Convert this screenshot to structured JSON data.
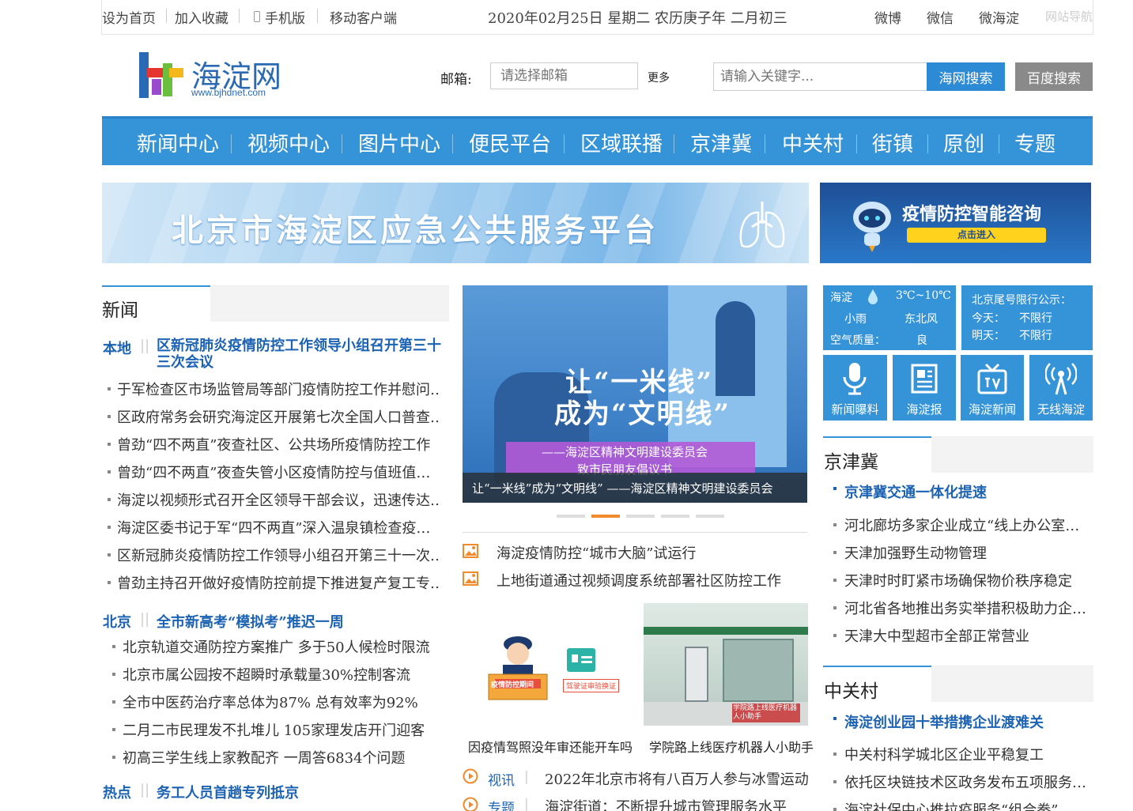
{
  "topbar": {
    "set_home": "设为首页",
    "bookmark": "加入收藏",
    "mobile": "手机版",
    "mobile_client": "移动客户端",
    "date": "2020年02月25日 星期二 农历庚子年 二月初三",
    "weibo": "微博",
    "weixin": "微信",
    "wei_haidian": "微海淀",
    "site_nav": "网站导航"
  },
  "logo": {
    "name": "海淀网",
    "url": "www.bjhdnet.com"
  },
  "mail": {
    "label": "邮箱:",
    "placeholder": "请选择邮箱",
    "more": "更多"
  },
  "search": {
    "placeholder": "请输入关键字...",
    "btn_hw": "海网搜索",
    "btn_baidu": "百度搜索"
  },
  "nav": [
    "新闻中心",
    "视频中心",
    "图片中心",
    "便民平台",
    "区域联播",
    "京津冀",
    "中关村",
    "街镇",
    "原创",
    "专题"
  ],
  "banner_main": "北京市海淀区应急公共服务平台",
  "banner_side": {
    "title": "疫情防控智能咨询",
    "btn": "点击进入"
  },
  "news": {
    "title": "新闻",
    "local": {
      "tag": "本地",
      "headline": "区新冠肺炎疫情防控工作领导小组召开第三十三次会议",
      "items": [
        "于军检查区市场监管局等部门疫情防控工作并慰问…",
        "区政府常务会研究海淀区开展第七次全国人口普查…",
        "曾劲“四不两直”夜查社区、公共场所疫情防控工作",
        "曾劲“四不两直”夜查失管小区疫情防控与值班值…",
        "海淀以视频形式召开全区领导干部会议，迅速传达…",
        "海淀区委书记于军“四不两直”深入温泉镇检查疫…",
        "区新冠肺炎疫情防控工作领导小组召开第三十一次…",
        "曾劲主持召开做好疫情防控前提下推进复产复工专…"
      ]
    },
    "beijing": {
      "tag": "北京",
      "headline": "全市新高考“模拟考”推迟一周",
      "items": [
        "北京轨道交通防控方案推广 多于50人候检时限流",
        "北京市属公园按不超瞬时承载量30%控制客流",
        "全市中医药治疗率总体为87% 总有效率为92%",
        "二月二市民理发不扎堆儿 105家理发店开门迎客",
        "初高三学生线上家教配齐 一周答6834个问题"
      ]
    },
    "hot": {
      "tag": "热点",
      "headline": "务工人员首趟专列抵京"
    }
  },
  "slide": {
    "line1": "让“一米线”",
    "line2": "成为“文明线”",
    "sub1": "——海淀区精神文明建设委员会",
    "sub2": "致市民朋友倡议书",
    "caption": "让“一米线”成为“文明线” ——海淀区精神文明建设委员会"
  },
  "pic_news": [
    "海淀疫情防控“城市大脑”试运行",
    "上地街道通过视频调度系统部署社区防控工作"
  ],
  "thumbs": [
    {
      "caption": "因疫情驾照没年审还能开车吗",
      "label1": "疫情防控期间",
      "label2": "驾驶证审验换证"
    },
    {
      "caption": "学院路上线医疗机器人小助手",
      "label": "学院路上线医疗机器人小助手"
    }
  ],
  "video_items": [
    {
      "tag": "视讯",
      "text": "2022年北京市将有八百万人参与冰雪运动"
    },
    {
      "tag": "专题",
      "text": "海淀街道：不断提升城市管理服务水平"
    }
  ],
  "weather": {
    "place": "海淀",
    "temp": "3℃~10℃",
    "cond": "小雨",
    "wind": "东北风",
    "aq_label": "空气质量：",
    "aq": "良"
  },
  "traffic": {
    "title": "北京尾号限行公示：",
    "today_label": "今天：",
    "today": "不限行",
    "tomorrow_label": "明天：",
    "tomorrow": "不限行"
  },
  "quick": [
    "新闻曝料",
    "海淀报",
    "海淀新闻",
    "无线海淀"
  ],
  "jjj": {
    "title": "京津冀",
    "headline": "京津冀交通一体化提速",
    "items": [
      "河北廊坊多家企业成立“线上办公室…",
      "天津加强野生动物管理",
      "天津时时盯紧市场确保物价秩序稳定",
      "河北省各地推出务实举措积极助力企…",
      "天津大中型超市全部正常营业"
    ]
  },
  "zgc": {
    "title": "中关村",
    "headline": "海淀创业园十举措携企业渡难关",
    "items": [
      "中关村科学城北区企业平稳复工",
      "依托区块链技术区政务发布五项服务…",
      "海淀社保中心推拉疫服务“组合拳”"
    ]
  },
  "colors": {
    "accent": "#3593d8",
    "link": "#1d63b3",
    "orange": "#f08a2c"
  }
}
